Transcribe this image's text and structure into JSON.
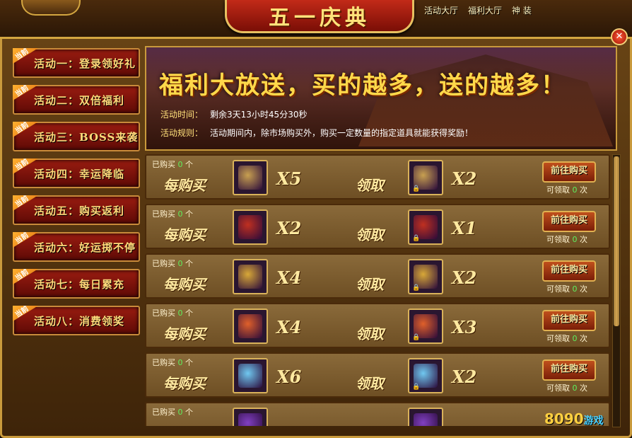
{
  "window": {
    "title": "五一庆典",
    "top_nav": [
      "活动大厅",
      "福利大厅",
      "神 装"
    ],
    "close_label": "✕"
  },
  "sidebar": {
    "ribbon": "当前",
    "items": [
      {
        "label": "活动一：登录领好礼"
      },
      {
        "label": "活动二：双倍福利"
      },
      {
        "label": "活动三：BOSS来袭"
      },
      {
        "label": "活动四：幸运降临"
      },
      {
        "label": "活动五：购买返利"
      },
      {
        "label": "活动六：好运掷不停"
      },
      {
        "label": "活动七：每日累充"
      },
      {
        "label": "活动八：消费领奖"
      }
    ]
  },
  "banner": {
    "slogan": "福利大放送，买的越多，送的越多！",
    "time_label": "活动时间：",
    "time_value": "剩余3天13小时45分30秒",
    "rule_label": "活动规则：",
    "rule_value": "活动期间内，除市场购买外，购买一定数量的指定道具就能获得奖励！"
  },
  "rows": [
    {
      "bought_prefix": "已购买",
      "bought_count": "0",
      "bought_suffix": "个",
      "each_buy": "每购买",
      "buy_mult": "X5",
      "receive": "领取",
      "get_mult": "X2",
      "go_label": "前往购买",
      "claim_prefix": "可领取",
      "claim_count": "0",
      "claim_suffix": "次",
      "icon": "scroll-icon",
      "icon_color": "#c8a050"
    },
    {
      "bought_prefix": "已购买",
      "bought_count": "0",
      "bought_suffix": "个",
      "each_buy": "每购买",
      "buy_mult": "X2",
      "receive": "领取",
      "get_mult": "X1",
      "go_label": "前往购买",
      "claim_prefix": "可领取",
      "claim_count": "0",
      "claim_suffix": "次",
      "icon": "firecracker-icon",
      "icon_color": "#c03020"
    },
    {
      "bought_prefix": "已购买",
      "bought_count": "0",
      "bought_suffix": "个",
      "each_buy": "每购买",
      "buy_mult": "X4",
      "receive": "领取",
      "get_mult": "X2",
      "go_label": "前往购买",
      "claim_prefix": "可领取",
      "claim_count": "0",
      "claim_suffix": "次",
      "icon": "golden-scroll-icon",
      "icon_color": "#d8a838"
    },
    {
      "bought_prefix": "已购买",
      "bought_count": "0",
      "bought_suffix": "个",
      "each_buy": "每购买",
      "buy_mult": "X4",
      "receive": "领取",
      "get_mult": "X3",
      "go_label": "前往购买",
      "claim_prefix": "可领取",
      "claim_count": "0",
      "claim_suffix": "次",
      "icon": "fire-stone-icon",
      "icon_color": "#e0602a"
    },
    {
      "bought_prefix": "已购买",
      "bought_count": "0",
      "bought_suffix": "个",
      "each_buy": "每购买",
      "buy_mult": "X6",
      "receive": "领取",
      "get_mult": "X2",
      "go_label": "前往购买",
      "claim_prefix": "可领取",
      "claim_count": "0",
      "claim_suffix": "次",
      "icon": "crystal-orb-icon",
      "icon_color": "#70c8f0"
    },
    {
      "bought_prefix": "已购买",
      "bought_count": "0",
      "bought_suffix": "个",
      "each_buy": "",
      "buy_mult": "",
      "receive": "",
      "get_mult": "",
      "go_label": "",
      "claim_prefix": "",
      "claim_count": "",
      "claim_suffix": "",
      "icon": "purple-gem-icon",
      "icon_color": "#8040c0"
    }
  ],
  "watermark": {
    "num": "8090",
    "text": "游戏"
  }
}
